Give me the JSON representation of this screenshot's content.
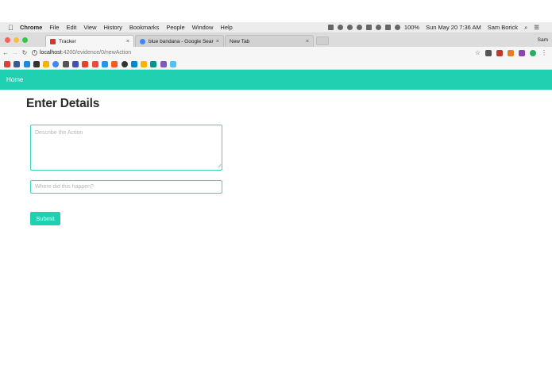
{
  "menubar": {
    "app": "Chrome",
    "items": [
      "File",
      "Edit",
      "View",
      "History",
      "Bookmarks",
      "People",
      "Window",
      "Help"
    ],
    "battery": "100%",
    "datetime": "Sun May 20  7:36 AM",
    "user": "Sam Borick"
  },
  "tabs": [
    {
      "title": "Tracker",
      "active": true,
      "color": "#dd3333"
    },
    {
      "title": "blue bandana - Google Search",
      "active": false,
      "color": "#4285f4"
    },
    {
      "title": "New Tab",
      "active": false,
      "color": "#cccccc"
    }
  ],
  "profile_name": "Sam",
  "address": {
    "host": "localhost",
    "path": ":4200/evidence/0/newAction"
  },
  "app": {
    "nav_home": "Home",
    "heading": "Enter Details",
    "action_placeholder": "Describe the Action",
    "location_placeholder": "Where did this happen?",
    "submit_label": "Submit"
  },
  "colors": {
    "accent": "#20d1b1",
    "input_border": "#3bd6bb"
  }
}
